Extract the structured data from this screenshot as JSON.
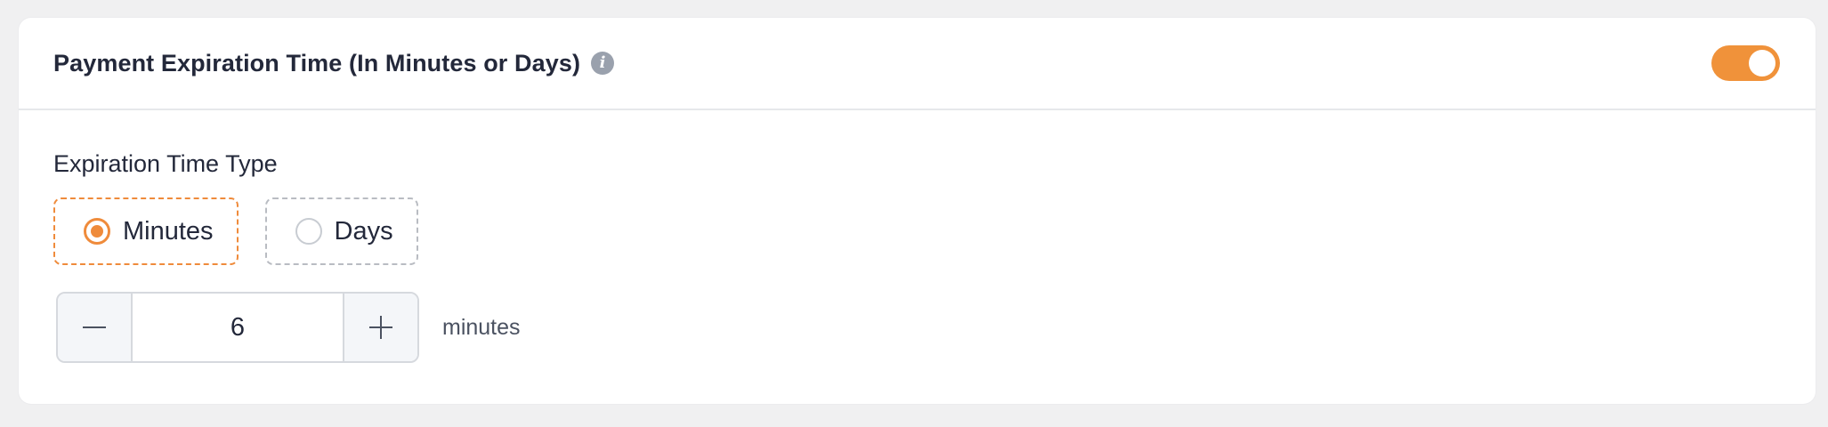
{
  "header": {
    "title": "Payment Expiration Time (In Minutes or Days)",
    "info_icon": "info-icon",
    "toggle_enabled": true
  },
  "expiration_type": {
    "label": "Expiration Time Type",
    "options": [
      {
        "label": "Minutes",
        "selected": true
      },
      {
        "label": "Days",
        "selected": false
      }
    ]
  },
  "stepper": {
    "value": "6",
    "unit": "minutes",
    "minus_icon": "minus-icon",
    "plus_icon": "plus-icon"
  },
  "colors": {
    "accent": "#f0923a",
    "text": "#23283a",
    "border": "#d6d9de",
    "background": "#f0f0f1"
  }
}
